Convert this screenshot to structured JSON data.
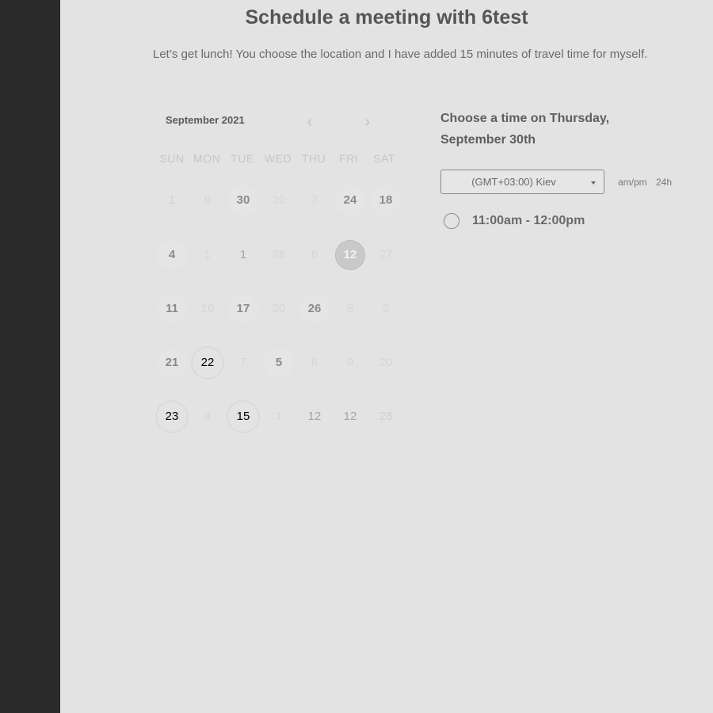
{
  "header": {
    "title": "Schedule a meeting with 6test",
    "subtitle": "Let’s get lunch! You choose the location and I have added 15 minutes of travel time for myself."
  },
  "calendar": {
    "month_label": "September 2021",
    "prev_icon": "‹",
    "next_icon": "›",
    "weekdays": [
      "SUN",
      "MON",
      "TUE",
      "WED",
      "THU",
      "FRI",
      "SAT"
    ],
    "weeks": [
      [
        {
          "label": "1",
          "state": "light"
        },
        {
          "label": "9",
          "state": "dim"
        },
        {
          "label": "30",
          "state": "available"
        },
        {
          "label": "20",
          "state": "dim"
        },
        {
          "label": "7",
          "state": "dim"
        },
        {
          "label": "24",
          "state": "available"
        },
        {
          "label": "18",
          "state": "available"
        }
      ],
      [
        {
          "label": "4",
          "state": "available"
        },
        {
          "label": "1",
          "state": "dim"
        },
        {
          "label": "1",
          "state": "mid"
        },
        {
          "label": "26",
          "state": "dim"
        },
        {
          "label": "6",
          "state": "dim"
        },
        {
          "label": "12",
          "state": "selected"
        },
        {
          "label": "27",
          "state": "dim"
        }
      ],
      [
        {
          "label": "11",
          "state": "available"
        },
        {
          "label": "16",
          "state": "dim"
        },
        {
          "label": "17",
          "state": "available"
        },
        {
          "label": "20",
          "state": "dim"
        },
        {
          "label": "26",
          "state": "available"
        },
        {
          "label": "8",
          "state": "dim"
        },
        {
          "label": "2",
          "state": "dim"
        }
      ],
      [
        {
          "label": "21",
          "state": "available"
        },
        {
          "label": "22",
          "state": "dotted"
        },
        {
          "label": "7",
          "state": "dim"
        },
        {
          "label": "5",
          "state": "available"
        },
        {
          "label": "6",
          "state": "dim"
        },
        {
          "label": "9",
          "state": "dim"
        },
        {
          "label": "20",
          "state": "dim"
        }
      ],
      [
        {
          "label": "23",
          "state": "dotted"
        },
        {
          "label": "4",
          "state": "dim"
        },
        {
          "label": "15",
          "state": "dotted"
        },
        {
          "label": "1",
          "state": "dim"
        },
        {
          "label": "12",
          "state": "mid"
        },
        {
          "label": "12",
          "state": "mid"
        },
        {
          "label": "28",
          "state": "light"
        }
      ]
    ]
  },
  "time_panel": {
    "heading": "Choose a time on Thursday, September 30th",
    "timezone": "(GMT+03:00) Kiev",
    "format_ampm": "am/pm",
    "format_24h": "24h",
    "slots": [
      "11:00am - 12:00pm"
    ]
  },
  "colors": {
    "sidebar": "#2a2a2a",
    "background": "#e3e3e3",
    "selected_day": "#c9c9c9"
  }
}
